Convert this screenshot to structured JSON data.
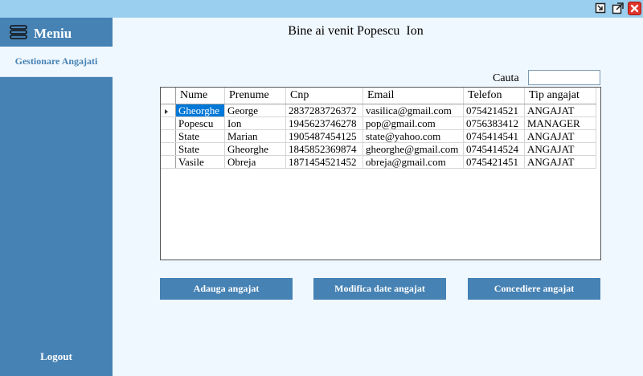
{
  "window": {
    "controls": [
      "minimize-icon",
      "maximize-icon",
      "close-icon"
    ]
  },
  "sidebar": {
    "menu_title": "Meniu",
    "menu_icon": "hamburger-icon",
    "items": [
      {
        "label": "Gestionare Angajati"
      }
    ],
    "logout_label": "Logout"
  },
  "main": {
    "greeting": "Bine ai venit Popescu  Ion",
    "search": {
      "label": "Cauta",
      "value": "",
      "placeholder": ""
    },
    "table": {
      "columns": [
        "Nume",
        "Prenume",
        "Cnp",
        "Email",
        "Telefon",
        "Tip angajat"
      ],
      "rows": [
        [
          "Gheorghe",
          "George",
          "2837283726372",
          "vasilica@gmail.com",
          "0754214521",
          "ANGAJAT"
        ],
        [
          "Popescu",
          "Ion",
          "1945623746278",
          "pop@gmail.com",
          "0756383412",
          "MANAGER"
        ],
        [
          "State",
          "Marian",
          "1905487454125",
          "state@yahoo.com",
          "0745414541",
          "ANGAJAT"
        ],
        [
          "State",
          "Gheorghe",
          "1845852369874",
          "gheorghe@gmail.com",
          "0745414524",
          "ANGAJAT"
        ],
        [
          "Vasile",
          "Obreja",
          "1871454521452",
          "obreja@gmail.com",
          "0745421451",
          "ANGAJAT"
        ]
      ]
    },
    "buttons": {
      "add": "Adauga angajat",
      "edit": "Modifica date angajat",
      "fire": "Concediere angajat"
    }
  },
  "colors": {
    "accent": "#4682B4",
    "background": "#F0F8FF",
    "titlebar": "#9BCFEF",
    "selection": "#0078D7"
  }
}
